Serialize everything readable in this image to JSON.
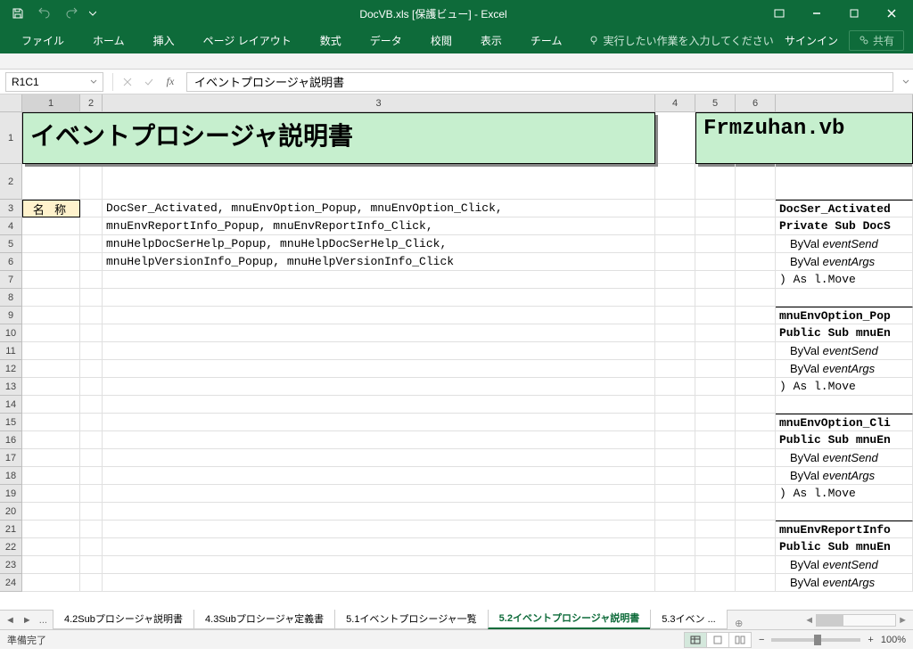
{
  "app": {
    "title": "DocVB.xls  [保護ビュー] - Excel"
  },
  "ribbon": {
    "tabs": [
      "ファイル",
      "ホーム",
      "挿入",
      "ページ レイアウト",
      "数式",
      "データ",
      "校閲",
      "表示",
      "チーム"
    ],
    "tell_me": "実行したい作業を入力してください",
    "signin": "サインイン",
    "share": "共有"
  },
  "formula": {
    "name_box": "R1C1",
    "content": "イベントプロシージャ説明書"
  },
  "columns": [
    "1",
    "2",
    "3",
    "4",
    "5",
    "6"
  ],
  "sheet": {
    "title_left": "イベントプロシージャ説明書",
    "title_right": "Frmzuhan.vb",
    "name_label": "名 称",
    "rows": [
      "DocSer_Activated, mnuEnvOption_Popup, mnuEnvOption_Click,",
      "mnuEnvReportInfo_Popup, mnuEnvReportInfo_Click,",
      "mnuHelpDocSerHelp_Popup, mnuHelpDocSerHelp_Click,",
      "mnuHelpVersionInfo_Popup, mnuHelpVersionInfo_Click"
    ],
    "code": [
      {
        "t": "DocSer_Activated",
        "cls": "bold border-t"
      },
      {
        "t": "Private Sub DocS",
        "cls": "bold"
      },
      {
        "t": "  ByVal eventSend",
        "cls": "italic"
      },
      {
        "t": "  ByVal eventArgs",
        "cls": "italic"
      },
      {
        "t": ") As l.Move",
        "cls": ""
      },
      {
        "t": "",
        "cls": ""
      },
      {
        "t": "mnuEnvOption_Pop",
        "cls": "bold border-t"
      },
      {
        "t": "Public Sub mnuEn",
        "cls": "bold"
      },
      {
        "t": "  ByVal eventSend",
        "cls": "italic"
      },
      {
        "t": "  ByVal eventArgs",
        "cls": "italic"
      },
      {
        "t": ") As l.Move",
        "cls": ""
      },
      {
        "t": "",
        "cls": ""
      },
      {
        "t": "mnuEnvOption_Cli",
        "cls": "bold border-t"
      },
      {
        "t": "Public Sub mnuEn",
        "cls": "bold"
      },
      {
        "t": "  ByVal eventSend",
        "cls": "italic"
      },
      {
        "t": "  ByVal eventArgs",
        "cls": "italic"
      },
      {
        "t": ") As l.Move",
        "cls": ""
      },
      {
        "t": "",
        "cls": ""
      },
      {
        "t": "mnuEnvReportInfo",
        "cls": "bold border-t"
      },
      {
        "t": "Public Sub mnuEn",
        "cls": "bold"
      },
      {
        "t": "  ByVal eventSend",
        "cls": "italic"
      },
      {
        "t": "  ByVal eventArgs",
        "cls": "italic"
      }
    ]
  },
  "tabs": {
    "items": [
      "4.2Subプロシージャ説明書",
      "4.3Subプロシージャ定義書",
      "5.1イベントプロシージャ一覧",
      "5.2イベントプロシージャ説明書",
      "5.3イベン"
    ],
    "active": 3,
    "ellipsis": "..."
  },
  "status": {
    "ready": "準備完了",
    "zoom": "100%"
  }
}
